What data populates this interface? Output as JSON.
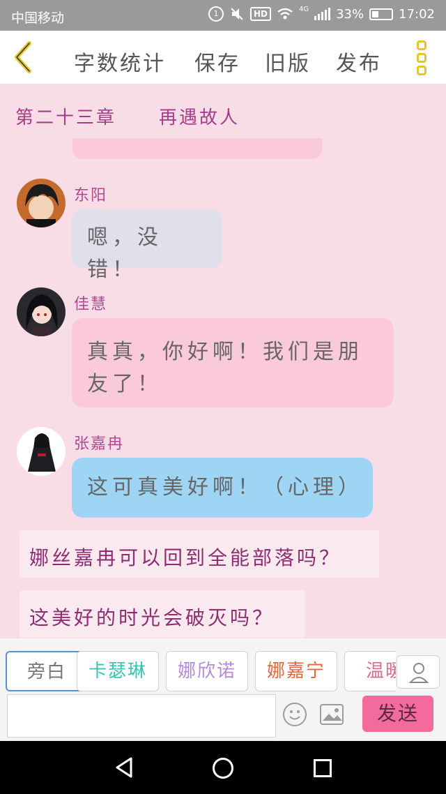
{
  "status_bar": {
    "carrier": "中国移动",
    "hd": "HD",
    "network": "4G",
    "battery": "33%",
    "time": "17:02",
    "icons": [
      "circle-mute-icon",
      "vibrate-off-icon",
      "hd-icon",
      "wifi-icon",
      "signal-icon",
      "battery-icon"
    ]
  },
  "toolbar": {
    "back_icon": "chevron-left-icon",
    "word_count": "字数统计",
    "save": "保存",
    "old_version": "旧版",
    "publish": "发布",
    "menu_icon": "more-vertical-icon",
    "accent": "#e5c52c"
  },
  "chapter": {
    "title": "第二十三章",
    "subtitle": "再遇故人"
  },
  "messages": [
    {
      "name": "东阳",
      "text": "嗯，没错！",
      "style": "gray"
    },
    {
      "name": "佳慧",
      "text": "真真，你好啊！我们是朋友了！",
      "style": "pink"
    },
    {
      "name": "张嘉冉",
      "text": "这可真美好啊！（心理）",
      "style": "blue"
    }
  ],
  "narration": [
    "娜丝嘉冉可以回到全能部落吗？",
    "这美好的时光会破灭吗？"
  ],
  "characters": [
    {
      "label": "旁白",
      "color": "#777777"
    },
    {
      "label": "卡瑟琳",
      "color": "#3cc3b5"
    },
    {
      "label": "娜欣诺",
      "color": "#b48ad8"
    },
    {
      "label": "娜嘉宁",
      "color": "#e3663c"
    },
    {
      "label": "温暖",
      "color": "#e06a8c"
    }
  ],
  "input": {
    "value": "",
    "send": "发送",
    "emoji_icon": "smile-icon",
    "image_icon": "image-icon",
    "person_icon": "person-icon"
  },
  "nav": {
    "back_icon": "triangle-back-icon",
    "home_icon": "circle-home-icon",
    "recent_icon": "square-recent-icon"
  }
}
